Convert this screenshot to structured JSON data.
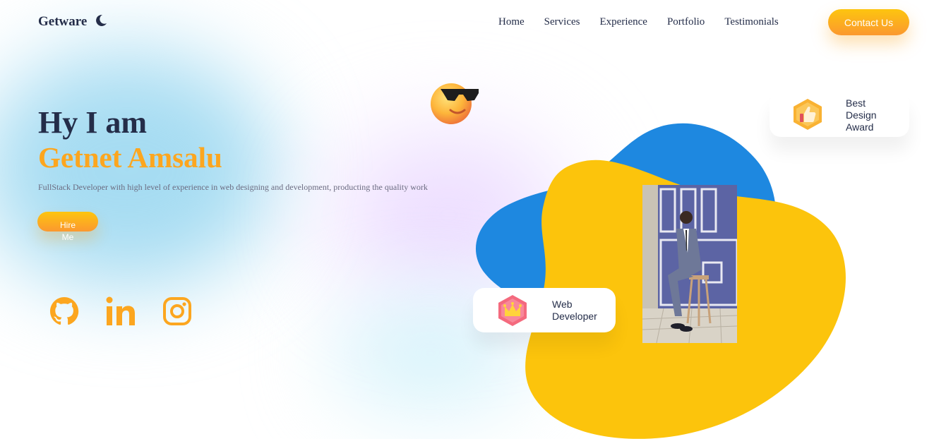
{
  "nav": {
    "brand": "Getware",
    "links": [
      "Home",
      "Services",
      "Experience",
      "Portfolio",
      "Testimonials"
    ],
    "contact_label": "Contact Us",
    "theme_icon": "moon-icon"
  },
  "intro": {
    "greeting": "Hy I am",
    "name": "Getnet Amsalu",
    "description": "FullStack Developer with high level of experience in web designing and development, producting the quality work",
    "hire_label": "Hire Me"
  },
  "socials": [
    {
      "icon": "github-icon"
    },
    {
      "icon": "linkedin-icon"
    },
    {
      "icon": "instagram-icon"
    }
  ],
  "badges": {
    "award": "Best Design Award",
    "developer": "Web Developer"
  },
  "colors": {
    "accent": "#fca61f",
    "dark": "#242d49",
    "blob_blue": "#1e88e0",
    "blob_yellow": "#fcc40c"
  }
}
